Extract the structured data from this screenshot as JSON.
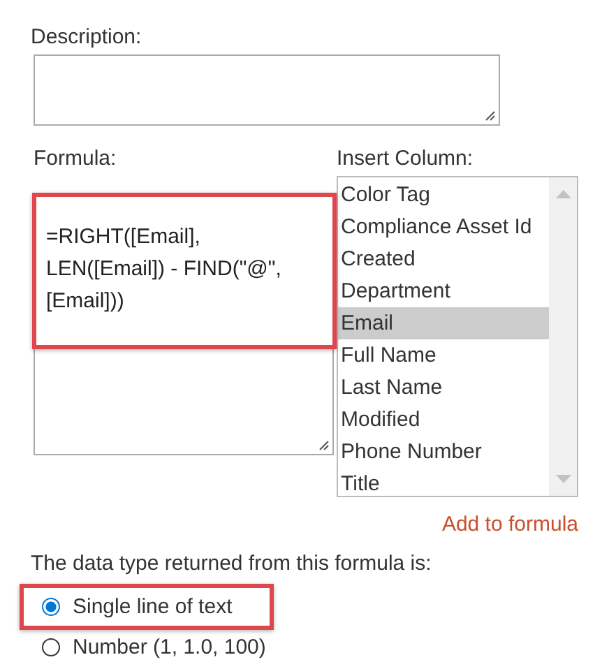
{
  "description": {
    "label": "Description:"
  },
  "formula": {
    "label": "Formula:",
    "value": "=RIGHT([Email], LEN([Email]) - FIND(\"@\", [Email]))"
  },
  "insert_column": {
    "label": "Insert Column:",
    "items": [
      {
        "label": "Color Tag",
        "selected": false
      },
      {
        "label": "Compliance Asset Id",
        "selected": false
      },
      {
        "label": "Created",
        "selected": false
      },
      {
        "label": "Department",
        "selected": false
      },
      {
        "label": "Email",
        "selected": true
      },
      {
        "label": "Full Name",
        "selected": false
      },
      {
        "label": "Last Name",
        "selected": false
      },
      {
        "label": "Modified",
        "selected": false
      },
      {
        "label": "Phone Number",
        "selected": false
      },
      {
        "label": "Title",
        "selected": false
      }
    ]
  },
  "add_link": "Add to formula",
  "return_type": {
    "label": "The data type returned from this formula is:",
    "options": [
      {
        "label": "Single line of text",
        "selected": true
      },
      {
        "label": "Number (1, 1.0, 100)",
        "selected": false
      }
    ]
  }
}
